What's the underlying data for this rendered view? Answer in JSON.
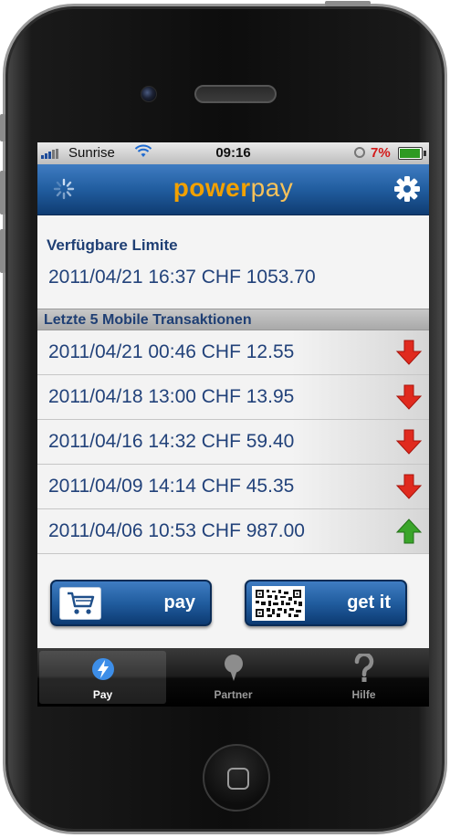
{
  "status_bar": {
    "carrier": "Sunrise",
    "time": "09:16",
    "battery_percent": "7%"
  },
  "header": {
    "logo_bold": "power",
    "logo_light": "pay",
    "left_icon": "spinner-icon",
    "right_icon": "gear-icon"
  },
  "limit_section": {
    "title": "Verfügbare Limite",
    "value": "2011/04/21 16:37 CHF 1053.70"
  },
  "transactions": {
    "header": "Letzte 5 Mobile Transaktionen",
    "items": [
      {
        "text": "2011/04/21 00:46 CHF 12.55",
        "direction": "down"
      },
      {
        "text": "2011/04/18 13:00 CHF 13.95",
        "direction": "down"
      },
      {
        "text": "2011/04/16 14:32 CHF 59.40",
        "direction": "down"
      },
      {
        "text": "2011/04/09 14:14 CHF 45.35",
        "direction": "down"
      },
      {
        "text": "2011/04/06 10:53 CHF 987.00",
        "direction": "up"
      }
    ]
  },
  "actions": {
    "pay_label": "pay",
    "getit_label": "get it"
  },
  "tabbar": {
    "tabs": [
      {
        "label": "Pay",
        "icon": "pay-icon",
        "selected": true
      },
      {
        "label": "Partner",
        "icon": "map-pin-icon",
        "selected": false
      },
      {
        "label": "Hilfe",
        "icon": "question-icon",
        "selected": false
      }
    ]
  },
  "colors": {
    "nav_blue": "#215d9f",
    "text_blue": "#22427a",
    "logo_orange": "#f2a100",
    "arrow_down": "#e02a1e",
    "arrow_up": "#3aa52a",
    "battery_red": "#d31a1a"
  }
}
